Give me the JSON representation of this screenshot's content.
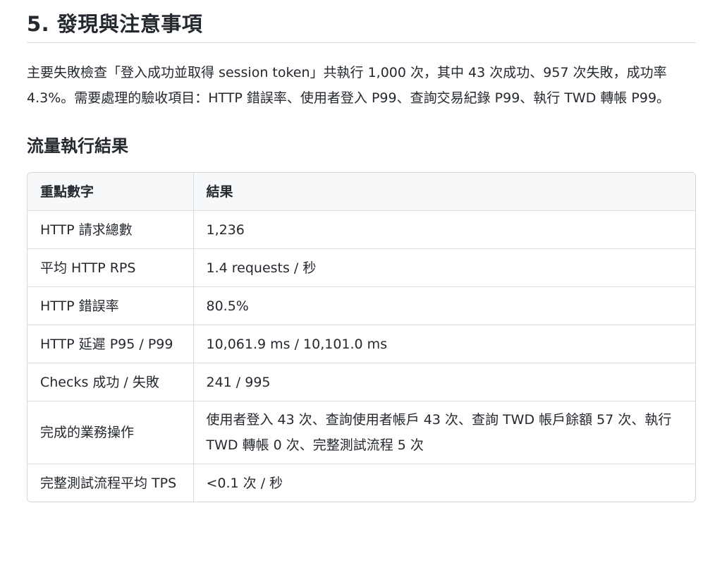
{
  "section": {
    "title": "5. 發現與注意事項",
    "summary": "主要失敗檢查「登入成功並取得 session token」共執行 1,000 次，其中 43 次成功、957 次失敗，成功率 4.3%。需要處理的驗收項目：HTTP 錯誤率、使用者登入 P99、查詢交易紀錄 P99、執行 TWD 轉帳 P99。"
  },
  "results": {
    "title": "流量執行結果",
    "headers": [
      "重點數字",
      "結果"
    ],
    "rows": [
      {
        "metric": "HTTP 請求總數",
        "value": "1,236"
      },
      {
        "metric": "平均 HTTP RPS",
        "value": "1.4 requests / 秒"
      },
      {
        "metric": "HTTP 錯誤率",
        "value": "80.5%"
      },
      {
        "metric": "HTTP 延遲 P95 / P99",
        "value": "10,061.9 ms / 10,101.0 ms"
      },
      {
        "metric": "Checks 成功 / 失敗",
        "value": "241 / 995"
      },
      {
        "metric": "完成的業務操作",
        "value": "使用者登入 43 次、查詢使用者帳戶 43 次、查詢 TWD 帳戶餘額 57 次、執行 TWD 轉帳 0 次、完整測試流程 5 次"
      },
      {
        "metric": "完整測試流程平均 TPS",
        "value": "<0.1 次 / 秒"
      }
    ]
  }
}
